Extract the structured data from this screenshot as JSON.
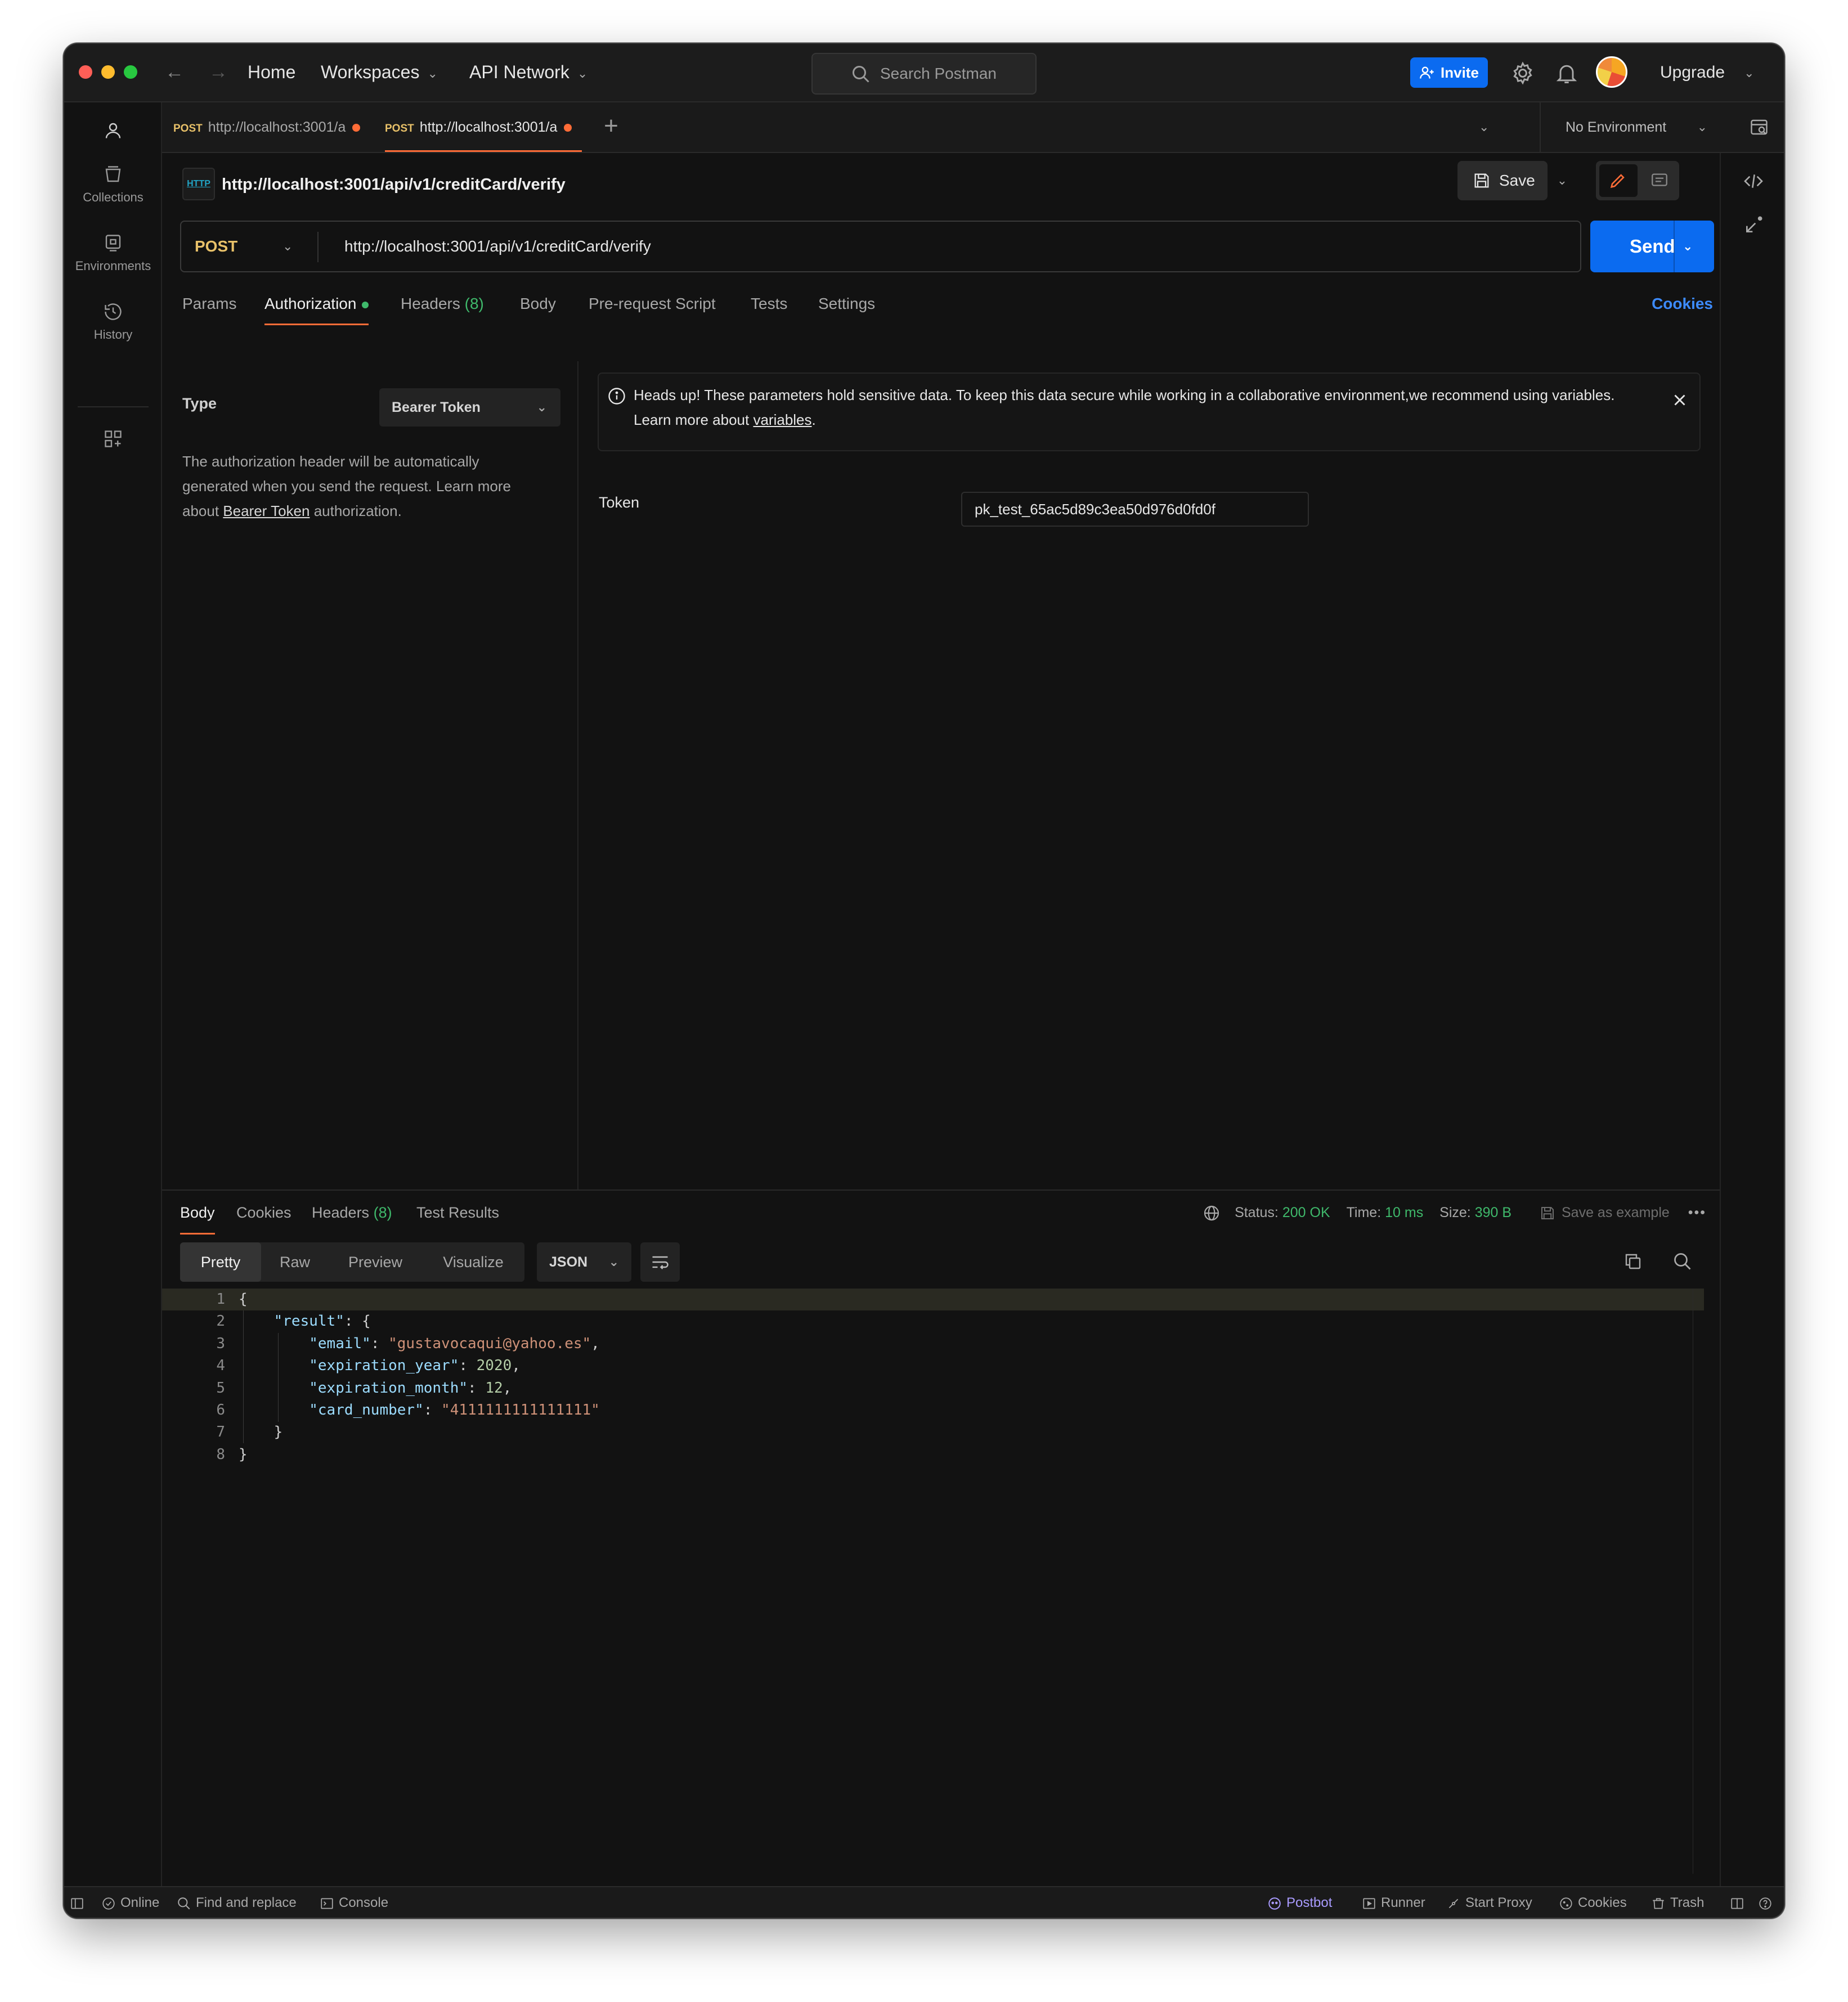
{
  "titlebar": {
    "nav": {
      "home": "Home",
      "workspaces": "Workspaces",
      "api_network": "API Network"
    },
    "search_placeholder": "Search Postman",
    "invite_label": "Invite",
    "upgrade_label": "Upgrade"
  },
  "sidebar": {
    "items": [
      {
        "label": "Collections",
        "icon": "collections-icon"
      },
      {
        "label": "Environments",
        "icon": "environments-icon"
      },
      {
        "label": "History",
        "icon": "history-icon"
      }
    ]
  },
  "tabs": [
    {
      "method": "POST",
      "label": "http://localhost:3001/a",
      "unsaved": true,
      "active": false
    },
    {
      "method": "POST",
      "label": "http://localhost:3001/a",
      "unsaved": true,
      "active": true
    }
  ],
  "environment": {
    "selected": "No Environment"
  },
  "request": {
    "title": "http://localhost:3001/api/v1/creditCard/verify",
    "badge": "HTTP",
    "save_label": "Save",
    "method": "POST",
    "url": "http://localhost:3001/api/v1/creditCard/verify",
    "send_label": "Send",
    "tabs": [
      {
        "label": "Params"
      },
      {
        "label": "Authorization"
      },
      {
        "label": "Headers",
        "count": "(8)"
      },
      {
        "label": "Body"
      },
      {
        "label": "Pre-request Script"
      },
      {
        "label": "Tests"
      },
      {
        "label": "Settings"
      }
    ],
    "cookies_label": "Cookies"
  },
  "auth": {
    "type_label": "Type",
    "type_value": "Bearer Token",
    "desc_1": "The authorization header will be automatically generated when you send the request. Learn more about ",
    "desc_link": "Bearer Token",
    "desc_2": " authorization.",
    "notice_1": "Heads up! These parameters hold sensitive data. To keep this data secure while working in a collaborative environment,we recommend using variables. Learn more about ",
    "notice_link": "variables",
    "notice_2": ".",
    "token_label": "Token",
    "token_value": "pk_test_65ac5d89c3ea50d976d0fd0f"
  },
  "response": {
    "tabs": [
      {
        "label": "Body"
      },
      {
        "label": "Cookies"
      },
      {
        "label": "Headers",
        "count": "(8)"
      },
      {
        "label": "Test Results"
      }
    ],
    "status_label": "Status:",
    "status_value": "200 OK",
    "time_label": "Time:",
    "time_value": "10 ms",
    "size_label": "Size:",
    "size_value": "390 B",
    "save_example": "Save as example",
    "formats": [
      "Pretty",
      "Raw",
      "Preview",
      "Visualize"
    ],
    "language": "JSON",
    "lines": [
      "1",
      "2",
      "3",
      "4",
      "5",
      "6",
      "7",
      "8"
    ],
    "json": {
      "l1": "{",
      "k_result": "\"result\"",
      "p_result": ": {",
      "k_email": "\"email\"",
      "v_email": "\"gustavocaqui@yahoo.es\"",
      "k_year": "\"expiration_year\"",
      "v_year": "2020",
      "k_month": "\"expiration_month\"",
      "v_month": "12",
      "k_card": "\"card_number\"",
      "v_card": "\"4111111111111111\"",
      "close_inner": "}",
      "close_outer": "}"
    }
  },
  "footer": {
    "online": "Online",
    "find_replace": "Find and replace",
    "console": "Console",
    "postbot": "Postbot",
    "runner": "Runner",
    "start_proxy": "Start Proxy",
    "cookies": "Cookies",
    "trash": "Trash"
  },
  "colors": {
    "accent_orange": "#ff6c37",
    "send_blue": "#0b6bf0",
    "method_post": "#e8c169",
    "status_green": "#3fb96b"
  }
}
